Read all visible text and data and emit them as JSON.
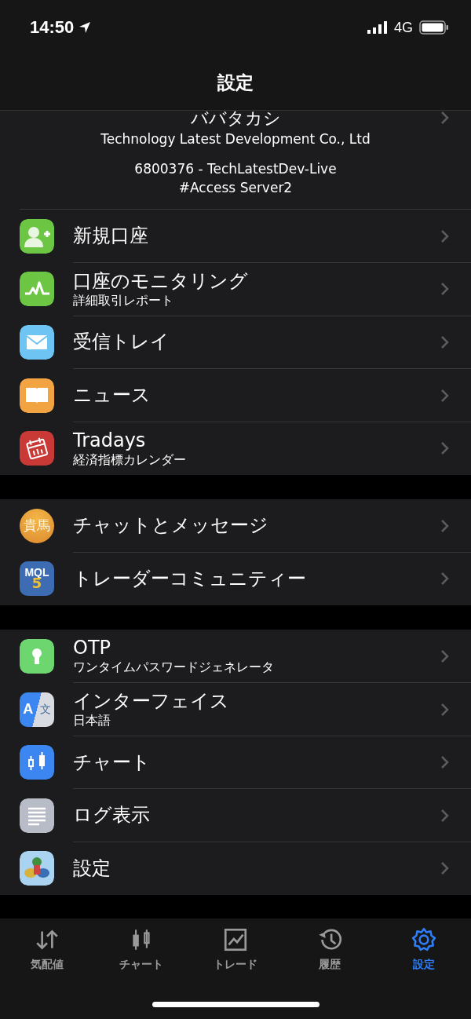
{
  "status_bar": {
    "time": "14:50",
    "network": "4G"
  },
  "header": {
    "title": "設定"
  },
  "account": {
    "name": "ババタカシ",
    "company": "Technology Latest Development Co., Ltd",
    "login": "6800376 - TechLatestDev-Live",
    "server": "#Access Server2"
  },
  "sections": [
    {
      "items": [
        {
          "label": "新規口座"
        },
        {
          "label": "口座のモニタリング",
          "sublabel": "詳細取引レポート"
        },
        {
          "label": "受信トレイ"
        },
        {
          "label": "ニュース"
        },
        {
          "label": "Tradays",
          "sublabel": "経済指標カレンダー"
        }
      ]
    },
    {
      "items": [
        {
          "label": "チャットとメッセージ",
          "icon_text": "貴馬"
        },
        {
          "label": "トレーダーコミュニティー",
          "icon_text": "MQL",
          "icon_subtext": "5"
        }
      ]
    },
    {
      "items": [
        {
          "label": "OTP",
          "sublabel": "ワンタイムパスワードジェネレータ"
        },
        {
          "label": "インターフェイス",
          "sublabel": "日本語",
          "icon_text": "A",
          "icon_subtext": "文"
        },
        {
          "label": "チャート"
        },
        {
          "label": "ログ表示"
        },
        {
          "label": "設定"
        }
      ]
    }
  ],
  "tab_bar": [
    {
      "label": "気配値",
      "selected": false
    },
    {
      "label": "チャート",
      "selected": false
    },
    {
      "label": "トレード",
      "selected": false
    },
    {
      "label": "履歴",
      "selected": false
    },
    {
      "label": "設定",
      "selected": true
    }
  ]
}
